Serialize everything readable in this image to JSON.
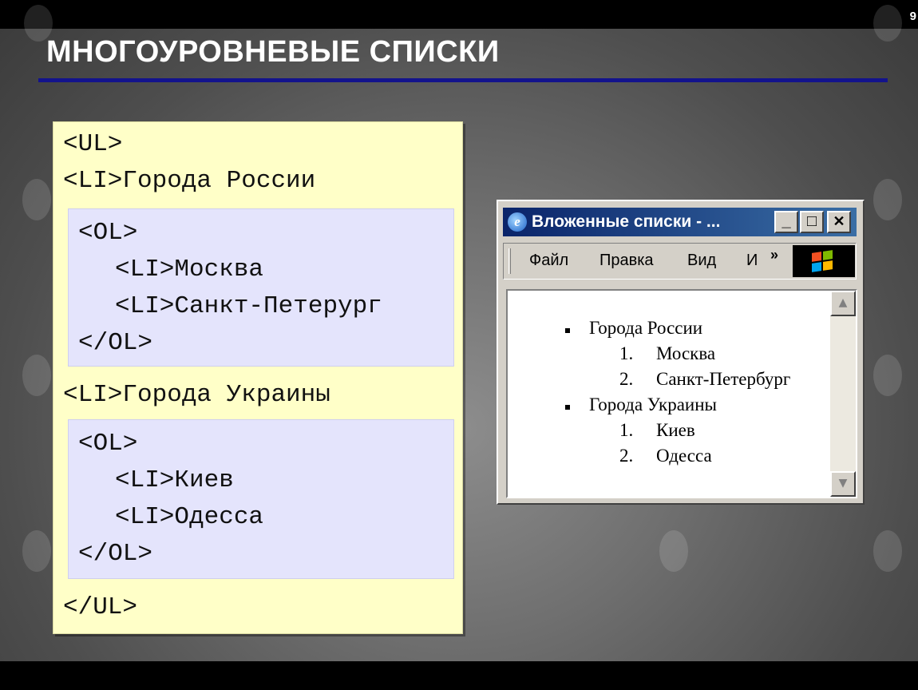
{
  "slide": {
    "page_number": "9",
    "title": "МНОГОУРОВНЕВЫЕ СПИСКИ"
  },
  "code": {
    "ul_open": "<UL>",
    "li1": "<LI>Города России",
    "ol1": {
      "open": "<OL>",
      "li_a": "<LI>Москва",
      "li_b": "<LI>Санкт-Петерург",
      "close": "</OL>"
    },
    "li2": "<LI>Города Украины",
    "ol2": {
      "open": "<OL>",
      "li_a": "<LI>Киев",
      "li_b": "<LI>Одесса",
      "close": "</OL>"
    },
    "ul_close": "</UL>"
  },
  "browser": {
    "icon_glyph": "e",
    "title": "Вложенные списки - ...",
    "buttons": {
      "minimize": "_",
      "maximize": "□",
      "close": "✕"
    },
    "menu": [
      "Файл",
      "Правка",
      "Вид",
      "И"
    ],
    "menu_more": "»",
    "scroll_up": "▲",
    "scroll_down": "▼",
    "list": {
      "group1": "Города России",
      "group1_items": [
        {
          "num": "1.",
          "text": "Москва"
        },
        {
          "num": "2.",
          "text": "Санкт-Петербург"
        }
      ],
      "group2": "Города Украины",
      "group2_items": [
        {
          "num": "1.",
          "text": "Киев"
        },
        {
          "num": "2.",
          "text": "Одесса"
        }
      ]
    },
    "colors": {
      "title_gradient_start": "#0a246a",
      "title_gradient_end": "#3a6ea5",
      "flag_red": "#f25022",
      "flag_green": "#7fba00",
      "flag_blue": "#00a4ef",
      "flag_yellow": "#ffb900"
    }
  }
}
